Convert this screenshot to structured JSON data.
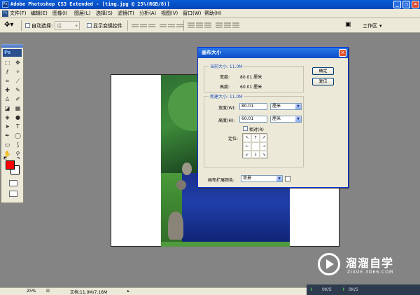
{
  "window": {
    "title": "Adobe Photoshop CS3 Extended - [timg.jpg @ 25%(RGB/8)]",
    "icon_text": "Ps"
  },
  "menu": [
    "文件(F)",
    "编辑(E)",
    "图像(I)",
    "图层(L)",
    "选择(S)",
    "滤镜(T)",
    "分析(A)",
    "视图(V)",
    "窗口(W)",
    "帮助(H)"
  ],
  "options": {
    "auto_select_label": "自动选择:",
    "auto_select_value": "组",
    "show_transform_label": "显示变换控件",
    "workspace_label": "工作区"
  },
  "toolbox": {
    "ps_label": "Ps",
    "colors": {
      "foreground": "#ff0000",
      "background": "#ffffff"
    }
  },
  "dialog": {
    "title": "画布大小",
    "current": {
      "legend": "当前大小: 11.0M",
      "width_label": "宽度:",
      "width_value": "80.01 厘米",
      "height_label": "高度:",
      "height_value": "60.01 厘米"
    },
    "new": {
      "legend": "新建大小: 11.0M",
      "width_label": "宽度(W):",
      "width_value": "80.01",
      "width_unit": "厘米",
      "height_label": "高度(H):",
      "height_value": "60.01",
      "height_unit": "厘米",
      "relative_label": "相对(R)",
      "anchor_label": "定位:"
    },
    "ext_color_label": "画布扩展颜色:",
    "ext_color_value": "背景",
    "ok": "确定",
    "reset": "复位"
  },
  "status": {
    "zoom": "25%",
    "doc": "文档:11.0M/7.16M"
  },
  "net": {
    "up": "0K/S",
    "down": "0K/S"
  },
  "watermark": {
    "name": "溜溜自学",
    "url": "ZIXUE.3D66.COM"
  }
}
